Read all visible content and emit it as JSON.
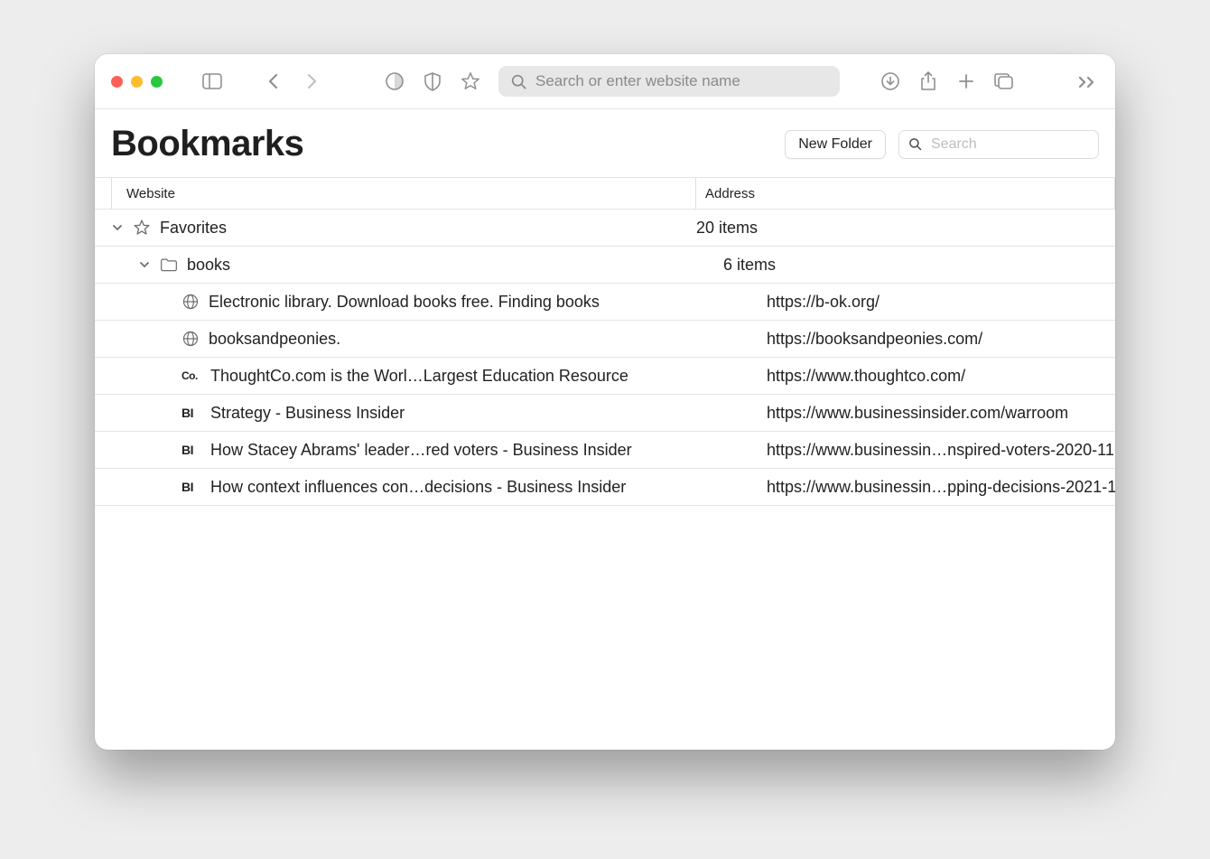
{
  "toolbar": {
    "url_placeholder": "Search or enter website name"
  },
  "page": {
    "title": "Bookmarks",
    "new_folder_label": "New Folder",
    "search_placeholder": "Search"
  },
  "columns": {
    "website": "Website",
    "address": "Address"
  },
  "tree": {
    "favorites": {
      "label": "Favorites",
      "count_text": "20 items",
      "books": {
        "label": "books",
        "count_text": "6 items",
        "items": [
          {
            "favicon": "globe",
            "title": "Electronic library. Download books free. Finding books",
            "address": "https://b-ok.org/"
          },
          {
            "favicon": "globe",
            "title": "booksandpeonies.",
            "address": "https://booksandpeonies.com/"
          },
          {
            "favicon": "co",
            "title": "ThoughtCo.com is the Worl…Largest Education Resource",
            "address": "https://www.thoughtco.com/"
          },
          {
            "favicon": "bi",
            "title": "Strategy - Business Insider",
            "address": "https://www.businessinsider.com/warroom"
          },
          {
            "favicon": "bi",
            "title": "How Stacey Abrams' leader…red voters - Business Insider",
            "address": "https://www.businessin…nspired-voters-2020-11"
          },
          {
            "favicon": "bi",
            "title": "How context influences con…decisions - Business Insider",
            "address": "https://www.businessin…pping-decisions-2021-1"
          }
        ]
      }
    }
  }
}
